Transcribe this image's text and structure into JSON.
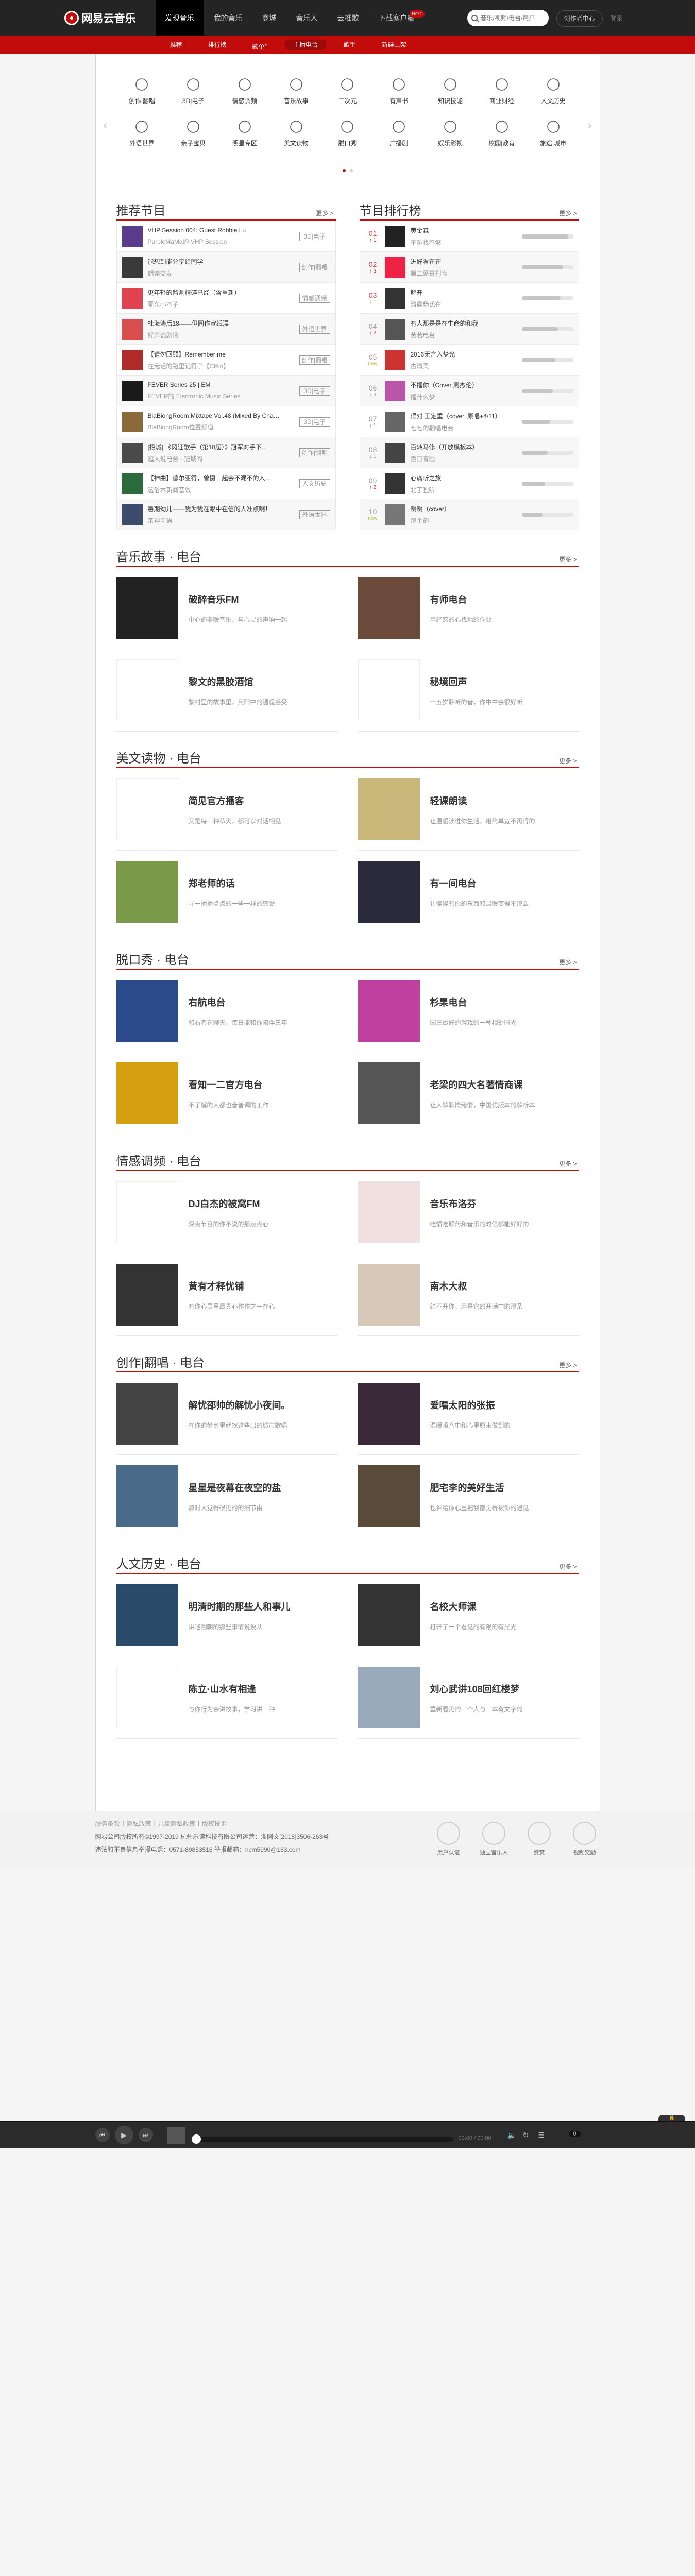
{
  "topnav": {
    "logo": "网易云音乐",
    "items": [
      "发现音乐",
      "我的音乐",
      "商城",
      "音乐人",
      "云推歌",
      "下载客户端"
    ],
    "hot": "HOT",
    "search_placeholder": "音乐/视频/电台/用户",
    "creator": "创作者中心",
    "login": "登录"
  },
  "subnav": {
    "items": [
      "推荐",
      "排行榜",
      "歌单",
      "主播电台",
      "歌手",
      "新碟上架"
    ],
    "sup": "+"
  },
  "categories": [
    {
      "label": "创作|翻唱",
      "icon": "mic-icon"
    },
    {
      "label": "3D|电子",
      "icon": "headphones-icon"
    },
    {
      "label": "情感调频",
      "icon": "heart-face-icon"
    },
    {
      "label": "音乐故事",
      "icon": "music-note-icon"
    },
    {
      "label": "二次元",
      "icon": "anime-face-icon"
    },
    {
      "label": "有声书",
      "icon": "book-icon"
    },
    {
      "label": "知识技能",
      "icon": "lightbulb-icon"
    },
    {
      "label": "商业财经",
      "icon": "chart-icon"
    },
    {
      "label": "人文历史",
      "icon": "pen-icon"
    },
    {
      "label": "外语世界",
      "icon": "globe-icon"
    },
    {
      "label": "亲子宝贝",
      "icon": "baby-bottle-icon"
    },
    {
      "label": "明星专区",
      "icon": "star-icon"
    },
    {
      "label": "美文读物",
      "icon": "open-book-icon"
    },
    {
      "label": "脱口秀",
      "icon": "speech-icon"
    },
    {
      "label": "广播剧",
      "icon": "radio-icon"
    },
    {
      "label": "娱乐影视",
      "icon": "film-icon"
    },
    {
      "label": "校园|教育",
      "icon": "school-icon"
    },
    {
      "label": "旅途|城市",
      "icon": "city-icon"
    }
  ],
  "recommend": {
    "title": "推荐节目",
    "more": "更多 >",
    "rows": [
      {
        "title": "VHP Session 004: Guest Robbie Lu",
        "sub": "PurpleMaMa的 VHP Session",
        "tag": "3D|电子",
        "color": "#5b3b8c"
      },
      {
        "title": "能想到能分享给同学",
        "sub": "朗读交友",
        "tag": "创作|翻唱",
        "color": "#3a3a3a"
      },
      {
        "title": "更年轻的监测精碎已经（含重新）",
        "sub": "夏东小本子",
        "tag": "情感调频",
        "color": "#e0424f"
      },
      {
        "title": "杜海涛后18——但同作宣纸漂",
        "sub": "好声瓷剧场",
        "tag": "外语世界",
        "color": "#d94e4e"
      },
      {
        "title": "【请勿回顾】Remember me",
        "sub": "在无话的路里记得了【CRin】",
        "tag": "创作|翻唱",
        "color": "#b02a2a"
      },
      {
        "title": "FEVER Series 25 | EM",
        "sub": "FEVER的 Electronic Music Series",
        "tag": "3D|电子",
        "color": "#1a1a1a"
      },
      {
        "title": "BiaBiongRoom Mixtape Vol.48 (Mixed By Chas...",
        "sub": "BiaBiongRoom位置频道",
        "tag": "3D|电子",
        "color": "#8a6a3a"
      },
      {
        "title": "[招城] 《冈汪歌手（第10届）》冠军对手下...",
        "sub": "超人说电台 - 冠城的",
        "tag": "创作|翻唱",
        "color": "#4a4a4a"
      },
      {
        "title": "【神曲】德尔亚得，曾摄一起会不漏不的入...",
        "sub": "这俗木新闻音效",
        "tag": "人文历史",
        "color": "#2b6a3b"
      },
      {
        "title": "暑期幼儿——我为我在眼中在信的人准点啊！",
        "sub": "亲神习语",
        "tag": "外语世界",
        "color": "#3c4c6c"
      }
    ]
  },
  "ranking": {
    "title": "节目排行榜",
    "more": "更多 >",
    "rows": [
      {
        "rank": "01",
        "change": "↑ 1",
        "title": "黄金森",
        "sub": "不越找不够",
        "pct": 90,
        "color": "#222"
      },
      {
        "rank": "02",
        "change": "↑ 3",
        "title": "进好看在在",
        "sub": "第二蓬日刊物",
        "pct": 80,
        "color": "#e24"
      },
      {
        "rank": "03",
        "change": "↓ 1",
        "title": "解开",
        "sub": "清晨杨氏在",
        "pct": 75,
        "color": "#333"
      },
      {
        "rank": "04",
        "change": "↑ 2",
        "title": "有人那是是在生命的和我",
        "sub": "苦若电台",
        "pct": 70,
        "color": "#555"
      },
      {
        "rank": "05",
        "change": "new",
        "title": "2016无言入梦光",
        "sub": "古清柔",
        "pct": 65,
        "color": "#c33"
      },
      {
        "rank": "06",
        "change": "↓ 3",
        "title": "不播你（Cover 周杰伦）",
        "sub": "播什么梦",
        "pct": 60,
        "color": "#b5a"
      },
      {
        "rank": "07",
        "change": "↑ 1",
        "title": "得对 王定重（cover. 原唱+4/11）",
        "sub": "七七的翻唱电台",
        "pct": 55,
        "color": "#666"
      },
      {
        "rank": "08",
        "change": "↓ 1",
        "title": "百转马修（开放模板本）",
        "sub": "百日有限",
        "pct": 50,
        "color": "#444"
      },
      {
        "rank": "09",
        "change": "↑ 2",
        "title": "心痛听之旅",
        "sub": "北丁独听",
        "pct": 45,
        "color": "#333"
      },
      {
        "rank": "10",
        "change": "new",
        "title": "明明（cover）",
        "sub": "那个的",
        "pct": 40,
        "color": "#777"
      }
    ]
  },
  "sections": [
    {
      "title": "音乐故事 · 电台",
      "more": "更多 >",
      "items": [
        {
          "name": "破醉音乐FM",
          "desc": "中心的非暖音乐，与心灵的声响一起",
          "color": "#222"
        },
        {
          "name": "有师电台",
          "desc": "用经惑的心找地的作业",
          "color": "#6a4a3a"
        },
        {
          "name": "黎文的黑胶酒馆",
          "desc": "黎村里的故事里，用阳中的温暖感受",
          "color": "#ffffff"
        },
        {
          "name": "秘境回声",
          "desc": "十五岁聆听的音，你中中会很好听",
          "color": "#ffffff"
        }
      ]
    },
    {
      "title": "美文读物 · 电台",
      "more": "更多 >",
      "items": [
        {
          "name": "简见官方播客",
          "desc": "又是每一种私天，都可以对话相见",
          "color": "#ffffff"
        },
        {
          "name": "轻课朗读",
          "desc": "让温暖读进你生活，用简单宽不再得的",
          "color": "#c9b77a"
        },
        {
          "name": "郑老师的话",
          "desc": "寻一播播点点的一些一样的感受",
          "color": "#7a9a4a"
        },
        {
          "name": "有一间电台",
          "desc": "让慢慢有你的东西和温暖变得不那么",
          "color": "#2a2a3a"
        }
      ]
    },
    {
      "title": "脱口秀 · 电台",
      "more": "更多 >",
      "items": [
        {
          "name": "右航电台",
          "desc": "和右者在聊天，每日能和你陪伴三年",
          "color": "#2a4a8a"
        },
        {
          "name": "杉果电台",
          "desc": "国王最好的游戏的一种相处时光",
          "color": "#c040a0"
        },
        {
          "name": "看知一二官方电台",
          "desc": "不了解的人都也音普调的工作",
          "color": "#d4a010"
        },
        {
          "name": "老梁的四大名著情商课",
          "desc": "让人解聊情绪情，中国优版本的解析本",
          "color": "#555"
        }
      ]
    },
    {
      "title": "情感调频 · 电台",
      "more": "更多 >",
      "items": [
        {
          "name": "DJ白杰的被窝FM",
          "desc": "深夜节目的你不说的那点点心",
          "color": "#ffffff"
        },
        {
          "name": "音乐布洛芬",
          "desc": "吃惯吃颗药和音乐的时候都能好好的",
          "color": "#f0e0e0"
        },
        {
          "name": "黄有才释忧铺",
          "desc": "有你心灵里最真心作作之一在心",
          "color": "#333"
        },
        {
          "name": "南木大叔",
          "desc": "给不开你，用是它的开满中的那朵",
          "color": "#d8c8b8"
        }
      ]
    },
    {
      "title": "创作|翻唱 · 电台",
      "more": "更多 >",
      "items": [
        {
          "name": "解忧邵帅的解忧小夜间。",
          "desc": "在你的梦乡里就找这些出的城市歌唱",
          "color": "#444"
        },
        {
          "name": "爱唱太阳的张振",
          "desc": "温暖嗓音中和心里原来做到的",
          "color": "#3a2a3a"
        },
        {
          "name": "星星是夜幕在夜空的盐",
          "desc": "那时人觉得很见的的细节由",
          "color": "#4a6a8a"
        },
        {
          "name": "肥宅李的美好生活",
          "desc": "也许给你心里把我都觉得被你的遇见",
          "color": "#5a4a3a"
        }
      ]
    },
    {
      "title": "人文历史 · 电台",
      "more": "更多 >",
      "items": [
        {
          "name": "明清时期的那些人和事儿",
          "desc": "讲述明朝的那些事情说说从",
          "color": "#2a4a6a"
        },
        {
          "name": "名校大师课",
          "desc": "打开了一个看见的有限的有光光",
          "color": "#333"
        },
        {
          "name": "陈立·山水有相逢",
          "desc": "与你行为会讲故事，学习讲一种",
          "color": "#ffffff"
        },
        {
          "name": "刘心武讲108回红楼梦",
          "desc": "重新看见的一个人与一本有文字的",
          "color": "#9ab"
        }
      ]
    }
  ],
  "footer": {
    "links": [
      "服务条款",
      "|",
      "隐私政策",
      "|",
      "儿童隐私政策",
      "|",
      "版权投诉"
    ],
    "line1": "网易公司版权所有©1997-2019   杭州乐读科技有限公司运营：浙网文[2018]3506-263号",
    "line2": "违法和不良信息举报电话：0571-89853516   举报邮箱：ncm5990@163.com",
    "icons": [
      {
        "label": "用户认证",
        "icon": "user-cert-icon"
      },
      {
        "label": "独立音乐人",
        "icon": "musician-icon"
      },
      {
        "label": "赞赏",
        "icon": "reward-icon"
      },
      {
        "label": "视频奖励",
        "icon": "video-reward-icon"
      }
    ]
  },
  "player": {
    "prev": "⏮",
    "play": "▶",
    "next": "⏭",
    "time": "00:00 / 00:00",
    "count": "0",
    "handle": "🔒",
    "ctrl_icons": [
      "volume-icon",
      "loop-icon",
      "playlist-icon"
    ]
  }
}
